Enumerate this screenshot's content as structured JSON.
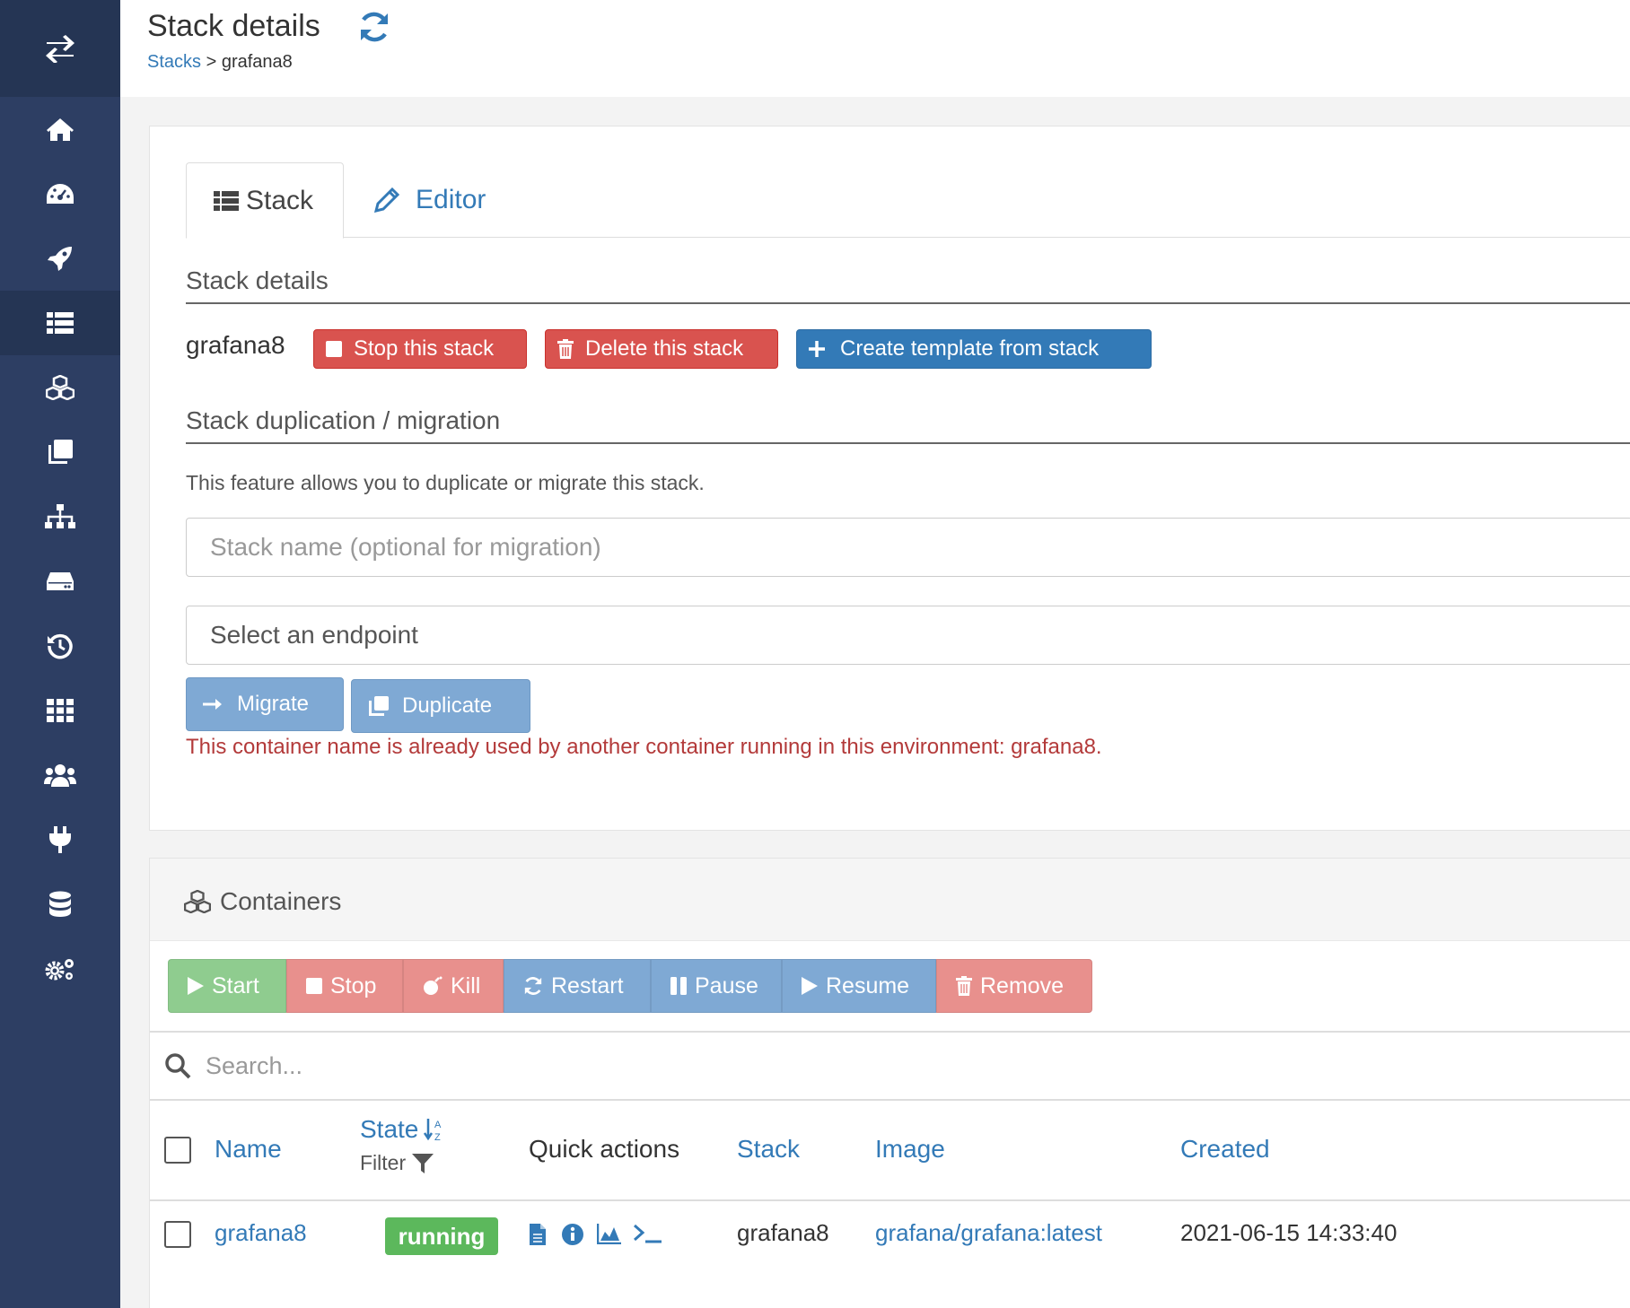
{
  "header": {
    "title": "Stack details",
    "breadcrumb_link": "Stacks",
    "breadcrumb_sep": ">",
    "breadcrumb_current": "grafana8"
  },
  "sidebar": {
    "items": [
      {
        "icon": "home-icon"
      },
      {
        "icon": "dashboard-icon"
      },
      {
        "icon": "rocket-icon"
      },
      {
        "icon": "list-icon",
        "active": true
      },
      {
        "icon": "cubes-icon"
      },
      {
        "icon": "clone-icon"
      },
      {
        "icon": "sitemap-icon"
      },
      {
        "icon": "hdd-icon"
      },
      {
        "icon": "history-icon"
      },
      {
        "icon": "th-icon"
      },
      {
        "icon": "users-icon"
      },
      {
        "icon": "plug-icon"
      },
      {
        "icon": "database-icon"
      },
      {
        "icon": "cogs-icon"
      }
    ]
  },
  "tabs": {
    "stack": "Stack",
    "editor": "Editor"
  },
  "details": {
    "section_title": "Stack details",
    "stack_name": "grafana8",
    "stop_label": "Stop this stack",
    "delete_label": "Delete this stack",
    "template_label": "Create template from stack"
  },
  "migration": {
    "section_title": "Stack duplication / migration",
    "help": "This feature allows you to duplicate or migrate this stack.",
    "name_placeholder": "Stack name (optional for migration)",
    "endpoint_placeholder": "Select an endpoint",
    "migrate_label": "Migrate",
    "duplicate_label": "Duplicate",
    "error": "This container name is already used by another container running in this environment: grafana8."
  },
  "containers": {
    "title": "Containers",
    "actions": {
      "start": "Start",
      "stop": "Stop",
      "kill": "Kill",
      "restart": "Restart",
      "pause": "Pause",
      "resume": "Resume",
      "remove": "Remove"
    },
    "search_placeholder": "Search...",
    "columns": {
      "name": "Name",
      "state": "State",
      "state_filter": "Filter",
      "quick_actions": "Quick actions",
      "stack": "Stack",
      "image": "Image",
      "created": "Created"
    },
    "rows": [
      {
        "name": "grafana8",
        "state": "running",
        "stack": "grafana8",
        "image": "grafana/grafana:latest",
        "created": "2021-06-15 14:33:40"
      }
    ]
  },
  "colors": {
    "sidebar": "#2d3e63",
    "primary": "#337ab7",
    "danger": "#d9534f",
    "success": "#5cb85c",
    "error_text": "#b33a3a"
  }
}
